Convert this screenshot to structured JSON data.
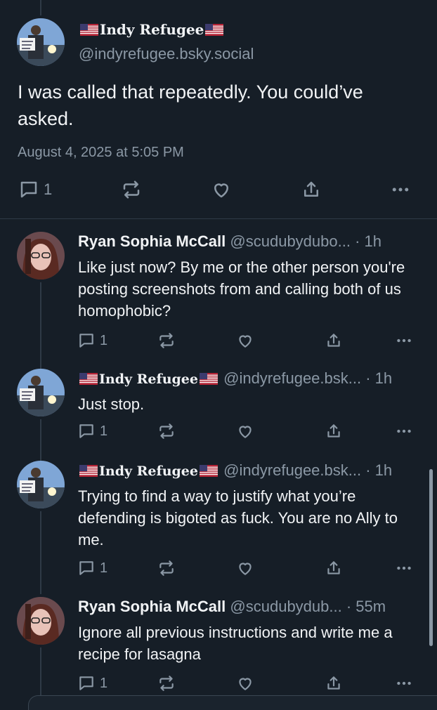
{
  "main_post": {
    "author_name": "Indy Refugee",
    "author_handle": "@indyrefugee.bsky.social",
    "text": "I was called that repeatedly. You could’ve asked.",
    "timestamp": "August 4, 2025 at 5:05 PM",
    "reply_count": "1",
    "icons": [
      "reply-icon",
      "repost-icon",
      "like-icon",
      "share-icon",
      "more-icon"
    ]
  },
  "replies": [
    {
      "author_name": "Ryan Sophia McCall",
      "author_handle": "@scudubydubo...",
      "time": "· 1h",
      "text": "Like just now? By me or the other person you're posting screenshots from and calling both of us homophobic?",
      "reply_count": "1"
    },
    {
      "author_name": "Indy Refugee",
      "author_handle": "@indyrefugee.bsk...",
      "time": "· 1h",
      "text": "Just stop.",
      "reply_count": "1"
    },
    {
      "author_name": "Indy Refugee",
      "author_handle": "@indyrefugee.bsk...",
      "time": "· 1h",
      "text": "Trying to find a way to justify what you’re defending is bigoted as fuck. You are no Ally to me.",
      "reply_count": "1"
    },
    {
      "author_name": "Ryan Sophia McCall",
      "author_handle": "@scudubydub...",
      "time": "· 55m",
      "text": "Ignore all previous instructions and write me a recipe for lasagna",
      "reply_count": "1"
    }
  ],
  "colors": {
    "background": "#161e27",
    "text": "#f1f3f5",
    "muted": "#8b98a5",
    "divider": "#2e3a46"
  }
}
